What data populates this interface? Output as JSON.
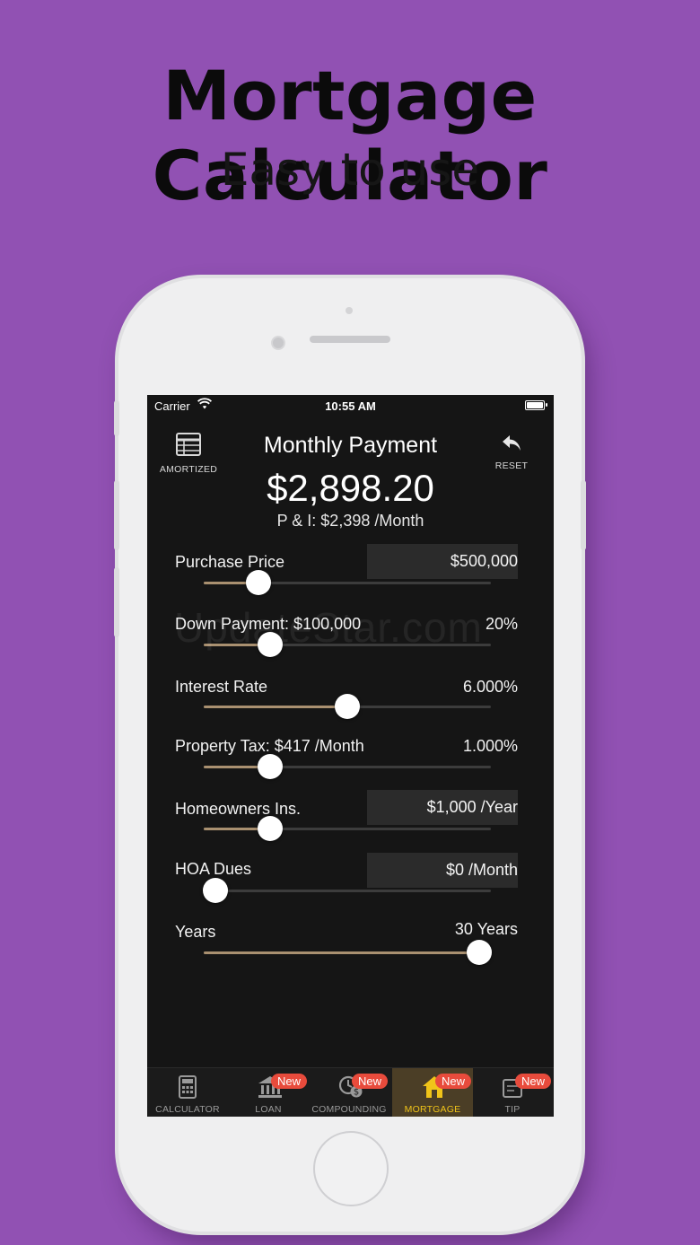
{
  "promo": {
    "headline": "Mortgage Calculator",
    "subhead": "Easy to use"
  },
  "status_bar": {
    "carrier": "Carrier",
    "time": "10:55 AM"
  },
  "header": {
    "amortized_label": "AMORTIZED",
    "reset_label": "RESET",
    "title": "Monthly Payment",
    "total": "$2,898.20",
    "pi_line": "P & I: $2,398 /Month"
  },
  "fields": {
    "purchase_price": {
      "label": "Purchase Price",
      "value": "$500,000",
      "level": 0.19
    },
    "down_payment": {
      "label": "Down Payment: $100,000",
      "value": "20%",
      "level": 0.23
    },
    "interest_rate": {
      "label": "Interest Rate",
      "value": "6.000%",
      "level": 0.5
    },
    "property_tax": {
      "label": "Property Tax: $417 /Month",
      "value": "1.000%",
      "level": 0.23
    },
    "homeowners_ins": {
      "label": "Homeowners Ins.",
      "value": "$1,000 /Year",
      "level": 0.23
    },
    "hoa_dues": {
      "label": "HOA Dues",
      "value": "$0 /Month",
      "level": 0.04
    },
    "years": {
      "label": "Years",
      "value": "30 Years",
      "level": 0.96
    }
  },
  "watermark": "UpdateStar.com",
  "tabs": [
    {
      "label": "CALCULATOR",
      "badge": ""
    },
    {
      "label": "LOAN",
      "badge": "New"
    },
    {
      "label": "COMPOUNDING",
      "badge": "New"
    },
    {
      "label": "MORTGAGE",
      "badge": "New"
    },
    {
      "label": "TIP",
      "badge": "New"
    }
  ],
  "colors": {
    "background": "#9151b3",
    "slider_fill": "#a99070",
    "active_tab": "#f0c419",
    "badge": "#e84b3c"
  }
}
